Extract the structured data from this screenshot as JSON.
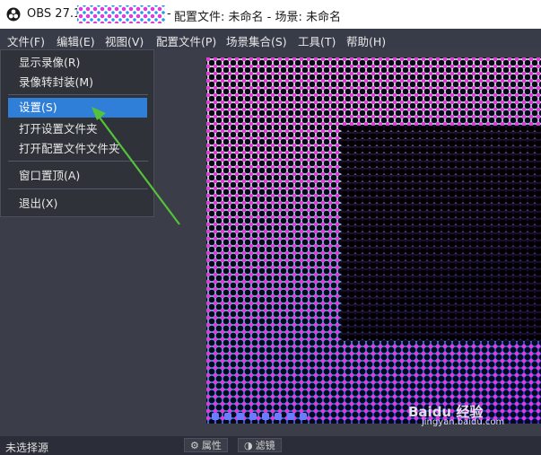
{
  "titlebar": {
    "app_version": "OBS 27.1.3",
    "separator": "-",
    "title_text": "配置文件: 未命名 - 场景: 未命名"
  },
  "menubar": {
    "items": [
      "文件(F)",
      "编辑(E)",
      "视图(V)",
      "配置文件(P)",
      "场景集合(S)",
      "工具(T)",
      "帮助(H)"
    ]
  },
  "file_menu": {
    "items": [
      "显示录像(R)",
      "录像转封装(M)",
      "设置(S)",
      "打开设置文件夹",
      "打开配置文件文件夹",
      "窗口置顶(A)",
      "退出(X)"
    ],
    "highlighted": "设置(S)"
  },
  "statusbar": {
    "label": "未选择源",
    "properties_button": "属性",
    "filters_button": "滤镜"
  },
  "watermark": {
    "brand": "Baidu 经验",
    "url": "jingyan.baidu.com"
  },
  "colors": {
    "highlight": "#2f7fd8",
    "arrow": "#55c23a",
    "menu_bg": "#383c48"
  }
}
